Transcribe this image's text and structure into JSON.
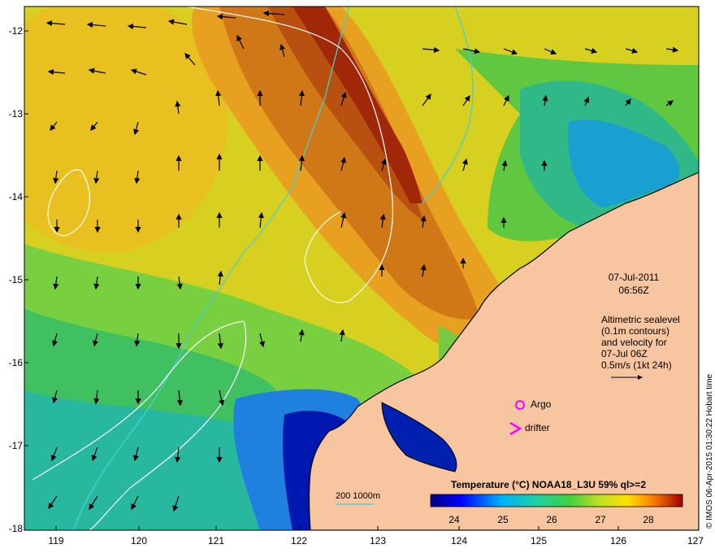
{
  "axes": {
    "lon_ticks": [
      "119",
      "120",
      "121",
      "122",
      "123",
      "124",
      "125",
      "126",
      "127"
    ],
    "lat_ticks": [
      "-12",
      "-13",
      "-14",
      "-15",
      "-16",
      "-17",
      "-18"
    ],
    "lon_range": [
      118.6,
      127.0
    ],
    "lat_range": [
      -18.0,
      -11.7
    ]
  },
  "timestamp": {
    "date": "07-Jul-2011",
    "time": "06:56Z"
  },
  "altimetry_note": {
    "line1": "Altimetric sealevel",
    "line2": "(0.1m contours)",
    "line3": "and velocity for",
    "line4": "07-Jul 06Z",
    "line5": "0.5m/s (1kt 24h)"
  },
  "legend": {
    "argo": "Argo",
    "drifter": "drifter"
  },
  "colorbar": {
    "title": "Temperature (°C) NOAA18_L3U 59% ql>=2",
    "ticks": [
      "24",
      "25",
      "26",
      "27",
      "28"
    ],
    "range": [
      23.3,
      28.7
    ]
  },
  "depth_legend": "200  1000m",
  "credit": "© IMOS 06-Apr-2015 01:30:22 Hobart time",
  "colors": {
    "land": "#f7c59f",
    "coast": "#000000",
    "contour_200": "#48cfd0",
    "sla_contour": "#ffffff",
    "argo": "#ff00ff",
    "drifter": "#ff00ff"
  }
}
